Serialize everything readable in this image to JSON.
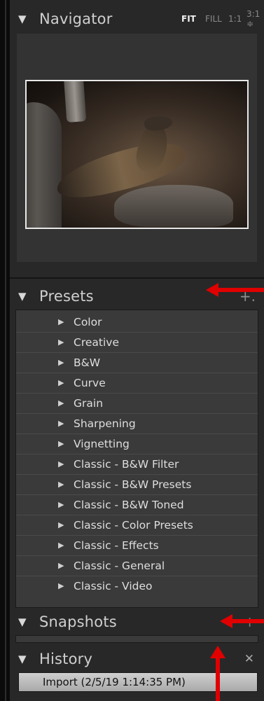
{
  "navigator": {
    "title": "Navigator",
    "zoom": [
      "FIT",
      "FILL",
      "1:1",
      "3:1 ≑"
    ],
    "active_zoom": "FIT"
  },
  "presets": {
    "title": "Presets",
    "add_label": "+.",
    "items": [
      {
        "label": "Color"
      },
      {
        "label": "Creative"
      },
      {
        "label": "B&W"
      },
      {
        "label": "Curve"
      },
      {
        "label": "Grain"
      },
      {
        "label": "Sharpening"
      },
      {
        "label": "Vignetting"
      },
      {
        "label": "Classic - B&W Filter"
      },
      {
        "label": "Classic - B&W Presets"
      },
      {
        "label": "Classic - B&W Toned"
      },
      {
        "label": "Classic - Color Presets"
      },
      {
        "label": "Classic - Effects"
      },
      {
        "label": "Classic - General"
      },
      {
        "label": "Classic - Video"
      }
    ]
  },
  "snapshots": {
    "title": "Snapshots",
    "add_label": "+"
  },
  "history": {
    "title": "History",
    "close_label": "✕",
    "items": [
      {
        "label": "Import (2/5/19 1:14:35 PM)"
      }
    ]
  },
  "icons": {
    "collapse": "disclosure-triangle-down-icon",
    "expand": "disclosure-triangle-right-icon",
    "annotation": "red-arrow-icon"
  },
  "colors": {
    "panel_bg": "#282828",
    "list_bg": "#3a3a3a",
    "arrow": "#e00000",
    "history_selected": "#bdbdbd"
  }
}
